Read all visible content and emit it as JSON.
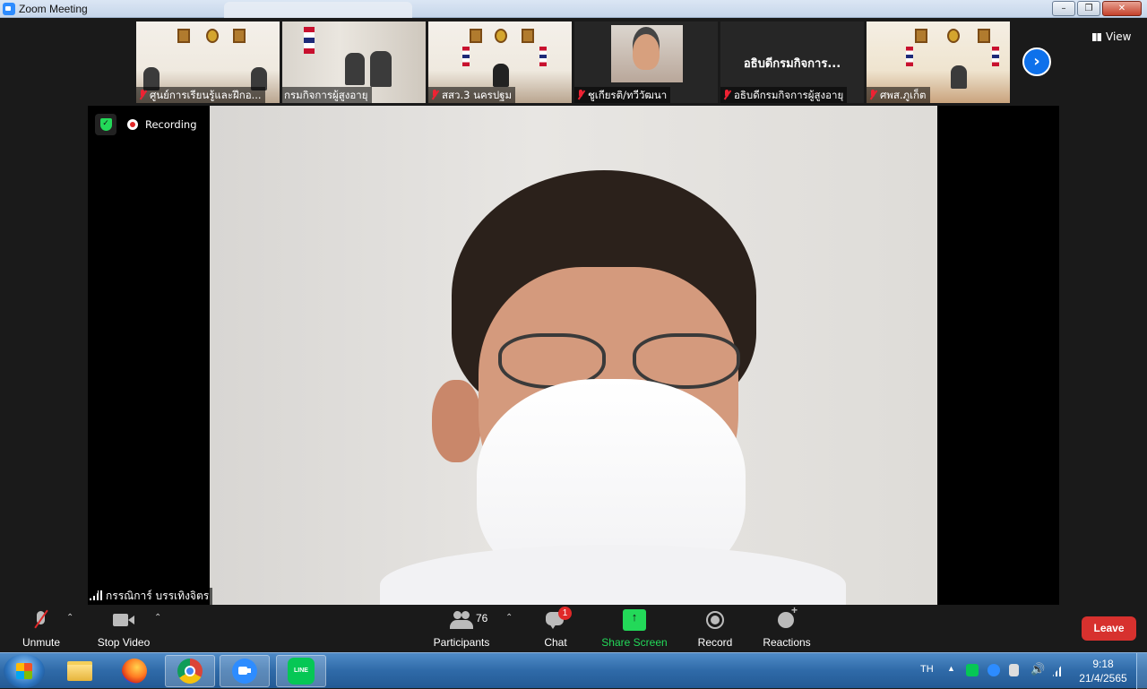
{
  "window": {
    "title": "Zoom Meeting"
  },
  "gallery": {
    "thumbnails": [
      {
        "name": "ศูนย์การเรียนรู้และฝึกอ...",
        "muted": true
      },
      {
        "name": "กรมกิจการผู้สูงอายุ",
        "muted": false
      },
      {
        "name": "สสว.3 นครปฐม",
        "muted": true
      },
      {
        "name": "ชูเกียรติ/ทวีวัฒนา",
        "muted": true
      },
      {
        "name": "อธิบดีกรมกิจการผู้สูงอายุ",
        "muted": true,
        "display_text": "อธิบดีกรมกิจการ..."
      },
      {
        "name": "ศพส.ภูเก็ต",
        "muted": true
      }
    ],
    "view_label": "View"
  },
  "speaker": {
    "recording_label": "Recording",
    "name": "กรรณิการ์ บรรเทิงจิตร"
  },
  "toolbar": {
    "unmute": "Unmute",
    "stop_video": "Stop Video",
    "participants": "Participants",
    "participants_count": "76",
    "chat": "Chat",
    "chat_badge": "1",
    "share_screen": "Share Screen",
    "record": "Record",
    "reactions": "Reactions",
    "leave": "Leave"
  },
  "taskbar": {
    "apps": [
      "windows-explorer",
      "firefox",
      "chrome",
      "zoom",
      "line"
    ],
    "line_label": "LINE",
    "language": "TH",
    "time": "9:18",
    "date": "21/4/2565"
  },
  "colors": {
    "zoom_blue": "#0e71eb",
    "leave_red": "#d7312e",
    "share_green": "#23d959",
    "recording_red": "#e02828"
  }
}
